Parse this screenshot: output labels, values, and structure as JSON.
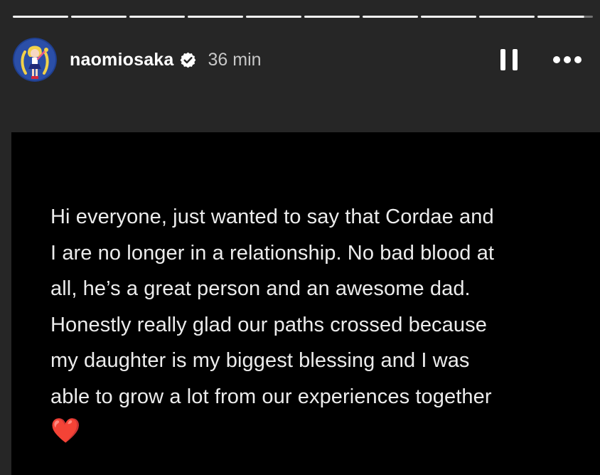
{
  "story": {
    "progress": {
      "segment_count": 10,
      "current_segment_fill_percent": 84
    },
    "header": {
      "username": "naomiosaka",
      "verified": true,
      "time_ago": "36 min",
      "avatar_icon": "sailor-moon-avatar-icon",
      "pause_icon": "pause-icon",
      "more_icon": "more-options-icon"
    },
    "content": {
      "lines": [
        "Hi everyone, just wanted to say that Cordae and",
        "I are no longer in a relationship. No bad blood at",
        "all, he’s a great person and an awesome dad.",
        "Honestly really glad our paths crossed because",
        "my daughter is my biggest blessing and I was",
        "able to grow a lot from our experiences together"
      ],
      "emoji": "❤️",
      "emoji_name": "red-heart-icon"
    },
    "colors": {
      "page_background": "#262626",
      "story_background": "#000000",
      "text": "#ececec",
      "heart": "#e1262d"
    }
  }
}
